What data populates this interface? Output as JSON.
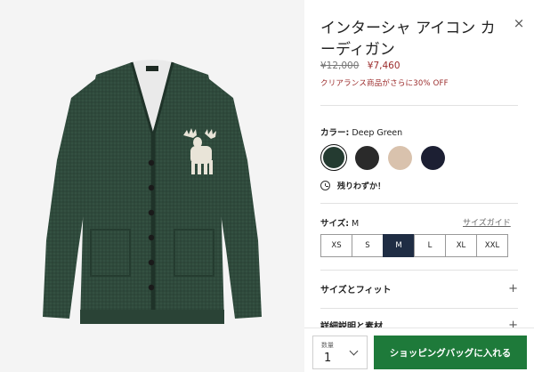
{
  "product": {
    "title": "インターシャ アイコン カーディガン",
    "price_old": "¥12,000",
    "price_new": "¥7,460",
    "promo": "クリアランス商品がさらに30% OFF",
    "close_symbol": "×"
  },
  "color": {
    "label": "カラー:",
    "selected_name": "Deep Green",
    "swatches": [
      {
        "name": "Deep Green",
        "hex": "#243b31",
        "selected": true
      },
      {
        "name": "Black",
        "hex": "#2a2a2a",
        "selected": false
      },
      {
        "name": "Oatmeal",
        "hex": "#d9c2ad",
        "selected": false
      },
      {
        "name": "Navy",
        "hex": "#1c1f33",
        "selected": false
      }
    ]
  },
  "stock": {
    "text": "残りわずか！"
  },
  "size": {
    "label": "サイズ:",
    "selected": "M",
    "guide_label": "サイズガイド",
    "options": [
      "XS",
      "S",
      "M",
      "L",
      "XL",
      "XXL"
    ]
  },
  "accordions": [
    {
      "label": "サイズとフィット",
      "symbol": "+"
    },
    {
      "label": "詳細説明と素材",
      "symbol": "+"
    }
  ],
  "cart": {
    "qty_label": "数量",
    "qty_value": "1",
    "add_label": "ショッピングバッグに入れる"
  },
  "colors": {
    "price_sale": "#9b2b2b",
    "add_button": "#1e7a3a",
    "size_selected": "#1f2d44",
    "garment": "#2f4a3c"
  }
}
